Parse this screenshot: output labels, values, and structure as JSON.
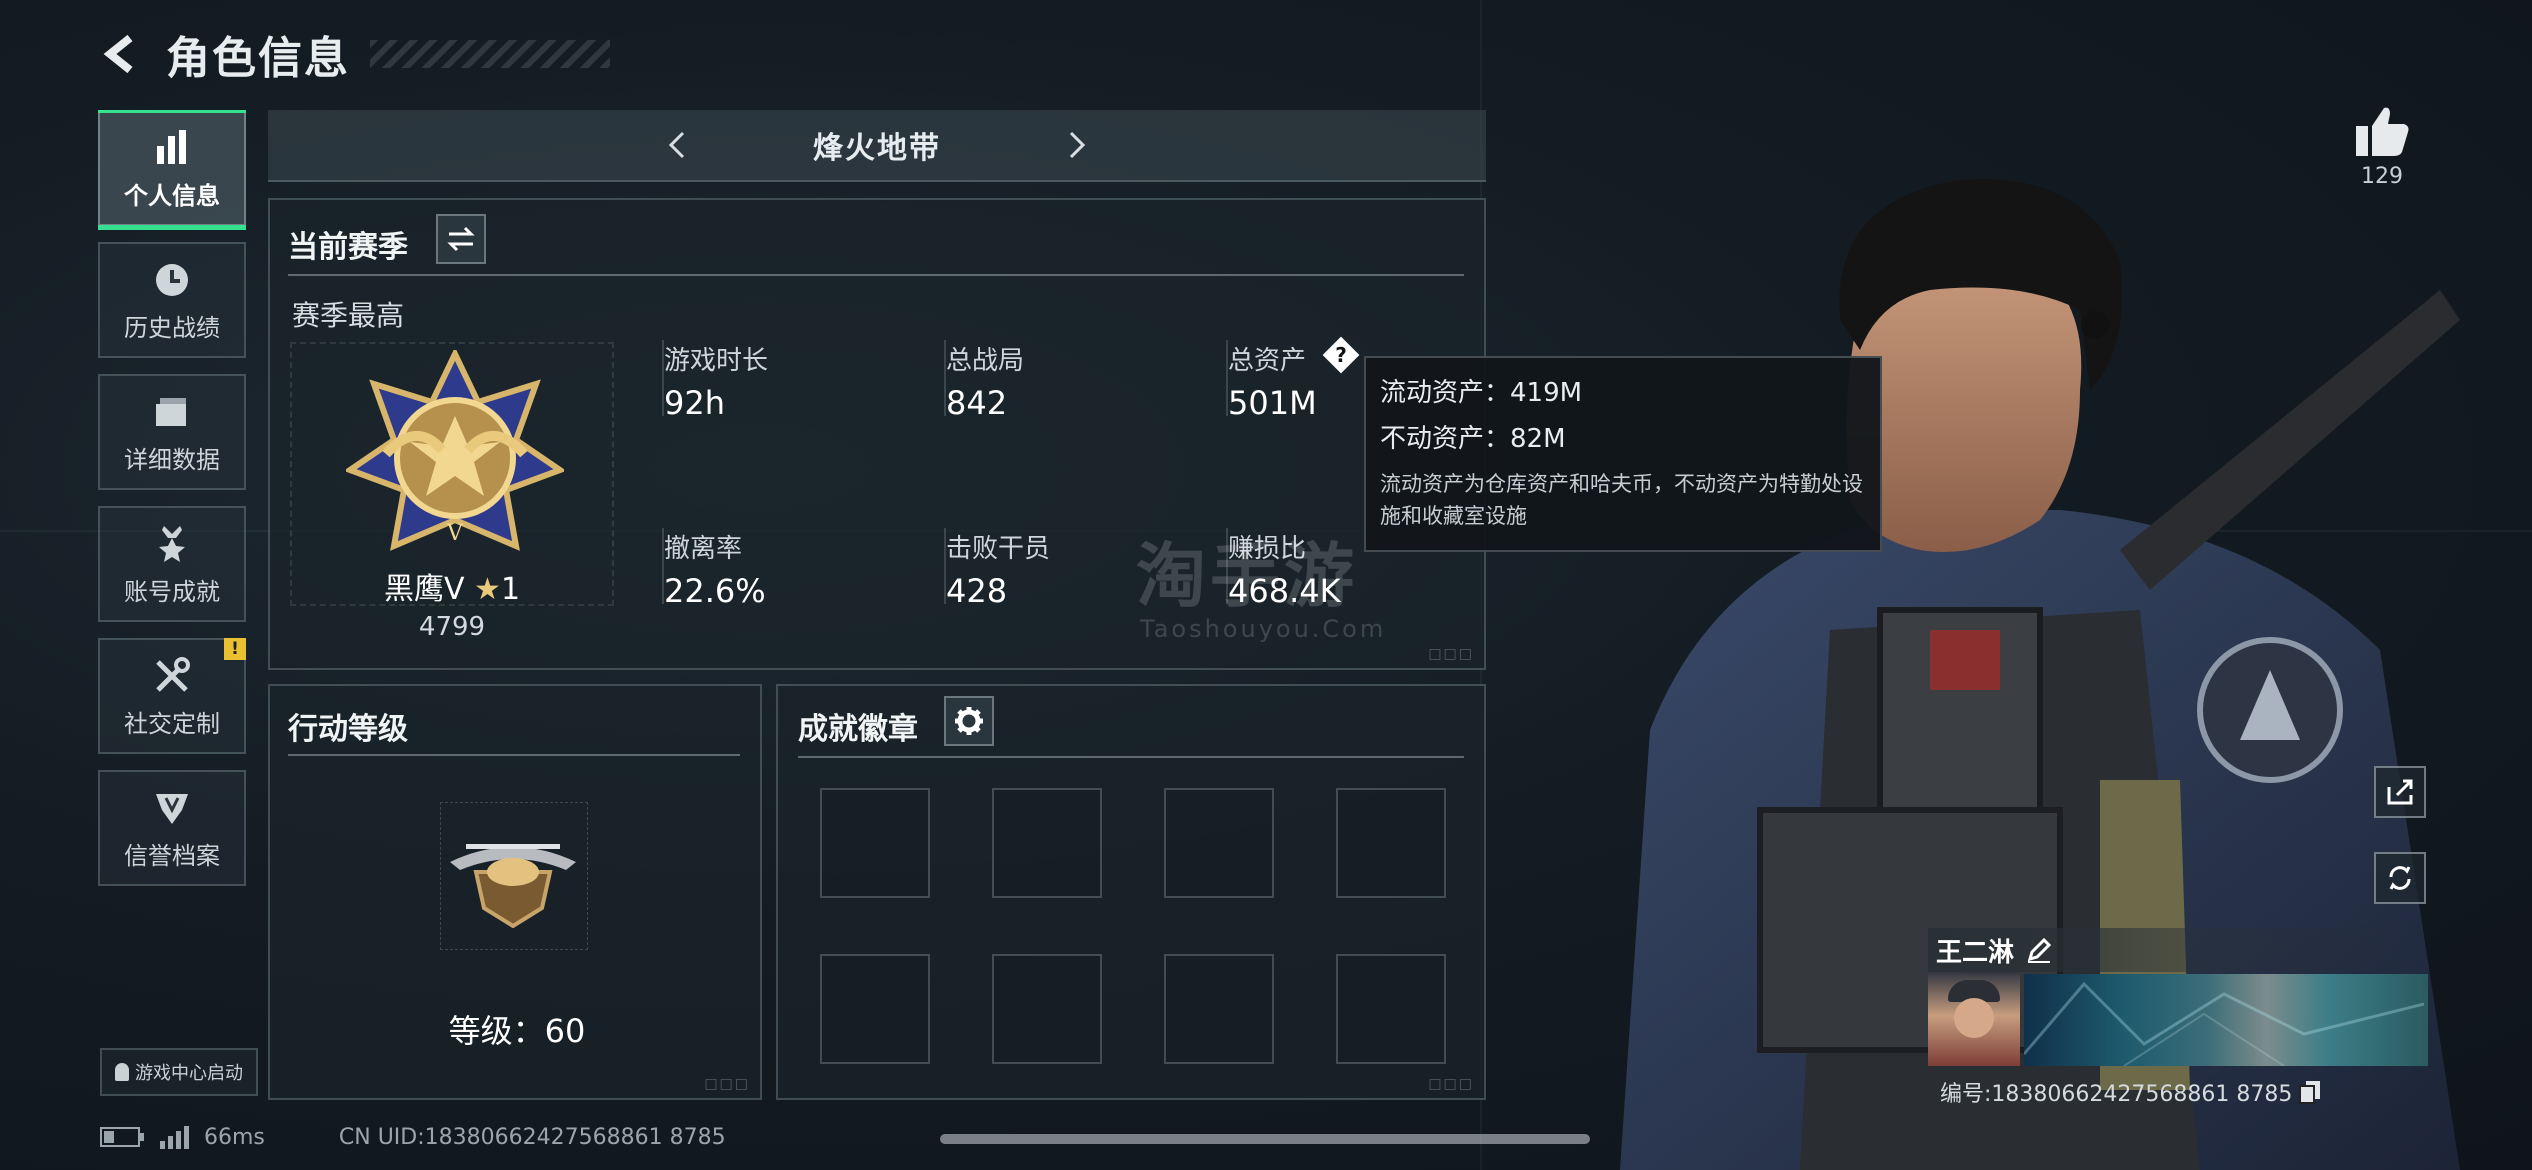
{
  "header": {
    "title": "角色信息"
  },
  "sidebar": {
    "items": [
      {
        "label": "个人信息",
        "icon": "bar-chart-icon"
      },
      {
        "label": "历史战绩",
        "icon": "clock-icon"
      },
      {
        "label": "详细数据",
        "icon": "folder-icon"
      },
      {
        "label": "账号成就",
        "icon": "medal-icon"
      },
      {
        "label": "社交定制",
        "icon": "tools-icon",
        "badge": "!"
      },
      {
        "label": "信誉档案",
        "icon": "shield-icon"
      }
    ],
    "game_center": "游戏中心启动"
  },
  "mode_selector": {
    "name": "烽火地带"
  },
  "season_panel": {
    "title": "当前赛季",
    "subtitle": "赛季最高",
    "rank_name": "黑鹰V",
    "rank_stars": "1",
    "rank_score": "4799",
    "stats": [
      {
        "label": "游戏时长",
        "value": "92h"
      },
      {
        "label": "总战局",
        "value": "842"
      },
      {
        "label": "总资产",
        "value": "501M"
      },
      {
        "label": "撤离率",
        "value": "22.6%"
      },
      {
        "label": "击败干员",
        "value": "428"
      },
      {
        "label": "赚损比",
        "value": "468.4K"
      }
    ]
  },
  "tooltip": {
    "liquid": "流动资产：419M",
    "fixed": "不动资产：82M",
    "description": "流动资产为仓库资产和哈夫币，不动资产为特勤处设施和收藏室设施"
  },
  "watermark": {
    "big": "淘手游",
    "small": "Taoshouyou.Com"
  },
  "level_panel": {
    "title": "行动等级",
    "level_text": "等级：60"
  },
  "badges_panel": {
    "title": "成就徽章",
    "slots": 8
  },
  "right": {
    "likes": "129",
    "player_name": "王二淋",
    "uid_label": "编号:18380662427568861 8785"
  },
  "status_bar": {
    "ping": "66ms",
    "uid": "CN UID:18380662427568861 8785"
  },
  "colors": {
    "accent": "#35e08e",
    "warning": "#e8c032",
    "background": "#111820"
  }
}
